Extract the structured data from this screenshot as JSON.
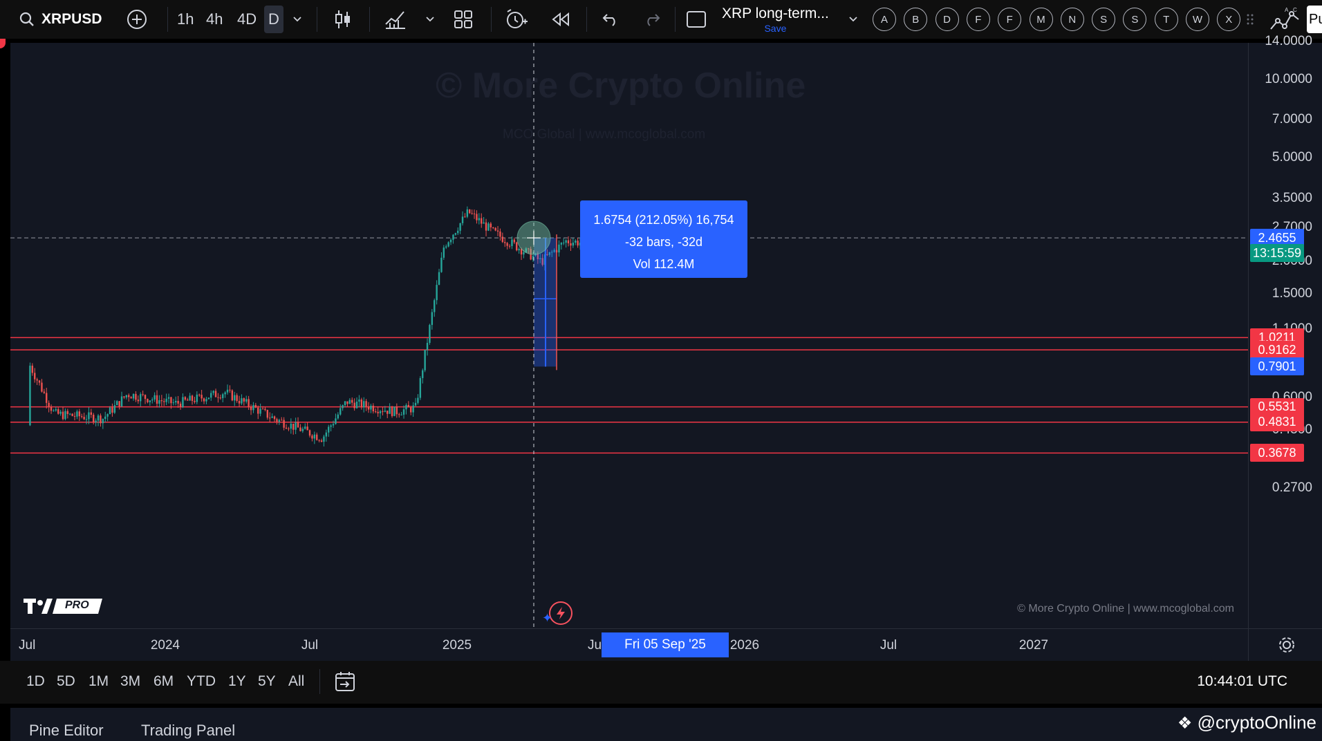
{
  "toolbar": {
    "symbol": "XRPUSD",
    "intervals": [
      "1h",
      "4h",
      "4D",
      "D"
    ],
    "active_interval": "D",
    "layout_name": "XRP long-term...",
    "save_label": "Save",
    "alphabet_buttons": [
      "A",
      "B",
      "D",
      "F",
      "F",
      "M",
      "N",
      "S",
      "S",
      "T",
      "W",
      "X"
    ],
    "right_cut_label": "Pu"
  },
  "watermark": {
    "title": "© More Crypto Online",
    "subtitle": "MCO Global   |   www.mcoglobal.com",
    "footer_copyright": "© More Crypto Online   |   www.mcoglobal.com"
  },
  "tv_badge": "PRO",
  "price_axis": {
    "ticks": [
      "14.0000",
      "10.0000",
      "7.0000",
      "5.0000",
      "3.5000",
      "2.7000",
      "2.0000",
      "1.5000",
      "1.1000",
      "0.6000",
      "0.4500",
      "0.2700"
    ],
    "current_price": "2.4655",
    "countdown": "13:15:59",
    "level_labels": [
      {
        "value": "1.0211",
        "color": "#f23645"
      },
      {
        "value": "0.9162",
        "color": "#f23645"
      },
      {
        "value": "0.7901",
        "color": "#2962ff"
      },
      {
        "value": "0.5531",
        "color": "#f23645"
      },
      {
        "value": "0.4831",
        "color": "#f23645"
      },
      {
        "value": "0.3678",
        "color": "#f23645"
      }
    ]
  },
  "time_axis": {
    "ticks": [
      "Jul",
      "2024",
      "Jul",
      "2025",
      "Ju",
      "'25",
      "2026",
      "Jul",
      "2027"
    ],
    "crosshair_date": "Fri 05 Sep '25"
  },
  "measure_tooltip": {
    "line1": "1.6754 (212.05%) 16,754",
    "line2": "-32 bars, -32d",
    "line3": "Vol 112.4M"
  },
  "range_buttons": [
    "1D",
    "5D",
    "1M",
    "3M",
    "6M",
    "YTD",
    "1Y",
    "5Y",
    "All"
  ],
  "clock": "10:44:01 UTC",
  "footer": {
    "tabs": [
      "Pine Editor",
      "Trading Panel"
    ],
    "promo": "@cryptoOnline"
  },
  "colors": {
    "background": "#131722",
    "support_line": "#f23645",
    "measure_blue": "#2962ff",
    "price_green": "#089981"
  },
  "chart_data": {
    "type": "candlestick",
    "symbol": "XRPUSD",
    "scale": "log",
    "ylim": [
      0.25,
      15
    ],
    "horizontal_levels": [
      1.0211,
      0.9162,
      0.5531,
      0.4831,
      0.3678
    ],
    "current_price": 2.4655,
    "measure_target": 0.7901,
    "approx_price_path": [
      {
        "date": "2023-07",
        "close": 0.47
      },
      {
        "date": "2023-07-13",
        "close": 0.82
      },
      {
        "date": "2023-08",
        "close": 0.52
      },
      {
        "date": "2023-10",
        "close": 0.5
      },
      {
        "date": "2023-11",
        "close": 0.62
      },
      {
        "date": "2024-01",
        "close": 0.57
      },
      {
        "date": "2024-03",
        "close": 0.63
      },
      {
        "date": "2024-05",
        "close": 0.5
      },
      {
        "date": "2024-07",
        "close": 0.42
      },
      {
        "date": "2024-08",
        "close": 0.58
      },
      {
        "date": "2024-10",
        "close": 0.53
      },
      {
        "date": "2024-11-10",
        "close": 0.55
      },
      {
        "date": "2024-12",
        "close": 2.3
      },
      {
        "date": "2025-01",
        "close": 3.1
      },
      {
        "date": "2025-02",
        "close": 2.6
      },
      {
        "date": "2025-04",
        "close": 2.0
      },
      {
        "date": "2025-05",
        "close": 2.4
      },
      {
        "date": "2025-07",
        "close": 2.3
      },
      {
        "date": "2025-08",
        "close": 2.8
      },
      {
        "date": "2025-09",
        "close": 2.47
      }
    ]
  }
}
